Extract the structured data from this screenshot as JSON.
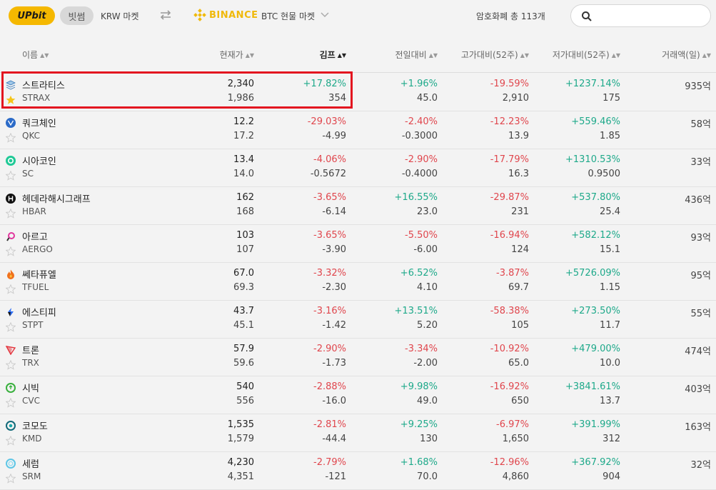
{
  "header": {
    "upbit_label": "UPbit",
    "bithumb_label": "빗썸",
    "krw_market": "KRW 마켓",
    "binance_label": "BINANCE",
    "btc_market": "BTC 현물 마켓",
    "total_count": "암호화폐 총 113개",
    "search_placeholder": ""
  },
  "columns": {
    "name": "이름",
    "price": "현재가",
    "kimp": "김프",
    "day": "전일대비",
    "high": "고가대비(52주)",
    "low": "저가대비(52주)",
    "volume": "거래액(일)"
  },
  "colors": {
    "up": "#1ea98a",
    "down": "#e0464d",
    "highlight": "#e3141f",
    "upbit": "#f5b800",
    "binance": "#f0b90b"
  },
  "rows": [
    {
      "name": "스트라티스",
      "symbol": "STRAX",
      "icon": "strax-icon",
      "favorite": true,
      "price": "2,340",
      "price_sub": "1,986",
      "kimp": "+17.82%",
      "kimp_sub": "354",
      "day": "+1.96%",
      "day_sub": "45.0",
      "high": "-19.59%",
      "high_sub": "2,910",
      "low": "+1237.14%",
      "low_sub": "175",
      "volume": "935억"
    },
    {
      "name": "쿼크체인",
      "symbol": "QKC",
      "icon": "qkc-icon",
      "favorite": false,
      "price": "12.2",
      "price_sub": "17.2",
      "kimp": "-29.03%",
      "kimp_sub": "-4.99",
      "day": "-2.40%",
      "day_sub": "-0.3000",
      "high": "-12.23%",
      "high_sub": "13.9",
      "low": "+559.46%",
      "low_sub": "1.85",
      "volume": "58억"
    },
    {
      "name": "시아코인",
      "symbol": "SC",
      "icon": "sc-icon",
      "favorite": false,
      "price": "13.4",
      "price_sub": "14.0",
      "kimp": "-4.06%",
      "kimp_sub": "-0.5672",
      "day": "-2.90%",
      "day_sub": "-0.4000",
      "high": "-17.79%",
      "high_sub": "16.3",
      "low": "+1310.53%",
      "low_sub": "0.9500",
      "volume": "33억"
    },
    {
      "name": "헤데라해시그래프",
      "symbol": "HBAR",
      "icon": "hbar-icon",
      "favorite": false,
      "price": "162",
      "price_sub": "168",
      "kimp": "-3.65%",
      "kimp_sub": "-6.14",
      "day": "+16.55%",
      "day_sub": "23.0",
      "high": "-29.87%",
      "high_sub": "231",
      "low": "+537.80%",
      "low_sub": "25.4",
      "volume": "436억"
    },
    {
      "name": "아르고",
      "symbol": "AERGO",
      "icon": "aergo-icon",
      "favorite": false,
      "price": "103",
      "price_sub": "107",
      "kimp": "-3.65%",
      "kimp_sub": "-3.90",
      "day": "-5.50%",
      "day_sub": "-6.00",
      "high": "-16.94%",
      "high_sub": "124",
      "low": "+582.12%",
      "low_sub": "15.1",
      "volume": "93억"
    },
    {
      "name": "쎄타퓨엘",
      "symbol": "TFUEL",
      "icon": "tfuel-icon",
      "favorite": false,
      "price": "67.0",
      "price_sub": "69.3",
      "kimp": "-3.32%",
      "kimp_sub": "-2.30",
      "day": "+6.52%",
      "day_sub": "4.10",
      "high": "-3.87%",
      "high_sub": "69.7",
      "low": "+5726.09%",
      "low_sub": "1.15",
      "volume": "95억"
    },
    {
      "name": "에스티피",
      "symbol": "STPT",
      "icon": "stpt-icon",
      "favorite": false,
      "price": "43.7",
      "price_sub": "45.1",
      "kimp": "-3.16%",
      "kimp_sub": "-1.42",
      "day": "+13.51%",
      "day_sub": "5.20",
      "high": "-58.38%",
      "high_sub": "105",
      "low": "+273.50%",
      "low_sub": "11.7",
      "volume": "55억"
    },
    {
      "name": "트론",
      "symbol": "TRX",
      "icon": "trx-icon",
      "favorite": false,
      "price": "57.9",
      "price_sub": "59.6",
      "kimp": "-2.90%",
      "kimp_sub": "-1.73",
      "day": "-3.34%",
      "day_sub": "-2.00",
      "high": "-10.92%",
      "high_sub": "65.0",
      "low": "+479.00%",
      "low_sub": "10.0",
      "volume": "474억"
    },
    {
      "name": "시빅",
      "symbol": "CVC",
      "icon": "cvc-icon",
      "favorite": false,
      "price": "540",
      "price_sub": "556",
      "kimp": "-2.88%",
      "kimp_sub": "-16.0",
      "day": "+9.98%",
      "day_sub": "49.0",
      "high": "-16.92%",
      "high_sub": "650",
      "low": "+3841.61%",
      "low_sub": "13.7",
      "volume": "403억"
    },
    {
      "name": "코모도",
      "symbol": "KMD",
      "icon": "kmd-icon",
      "favorite": false,
      "price": "1,535",
      "price_sub": "1,579",
      "kimp": "-2.81%",
      "kimp_sub": "-44.4",
      "day": "+9.25%",
      "day_sub": "130",
      "high": "-6.97%",
      "high_sub": "1,650",
      "low": "+391.99%",
      "low_sub": "312",
      "volume": "163억"
    },
    {
      "name": "세럼",
      "symbol": "SRM",
      "icon": "srm-icon",
      "favorite": false,
      "price": "4,230",
      "price_sub": "4,351",
      "kimp": "-2.79%",
      "kimp_sub": "-121",
      "day": "+1.68%",
      "day_sub": "70.0",
      "high": "-12.96%",
      "high_sub": "4,860",
      "low": "+367.92%",
      "low_sub": "904",
      "volume": "32억"
    }
  ]
}
